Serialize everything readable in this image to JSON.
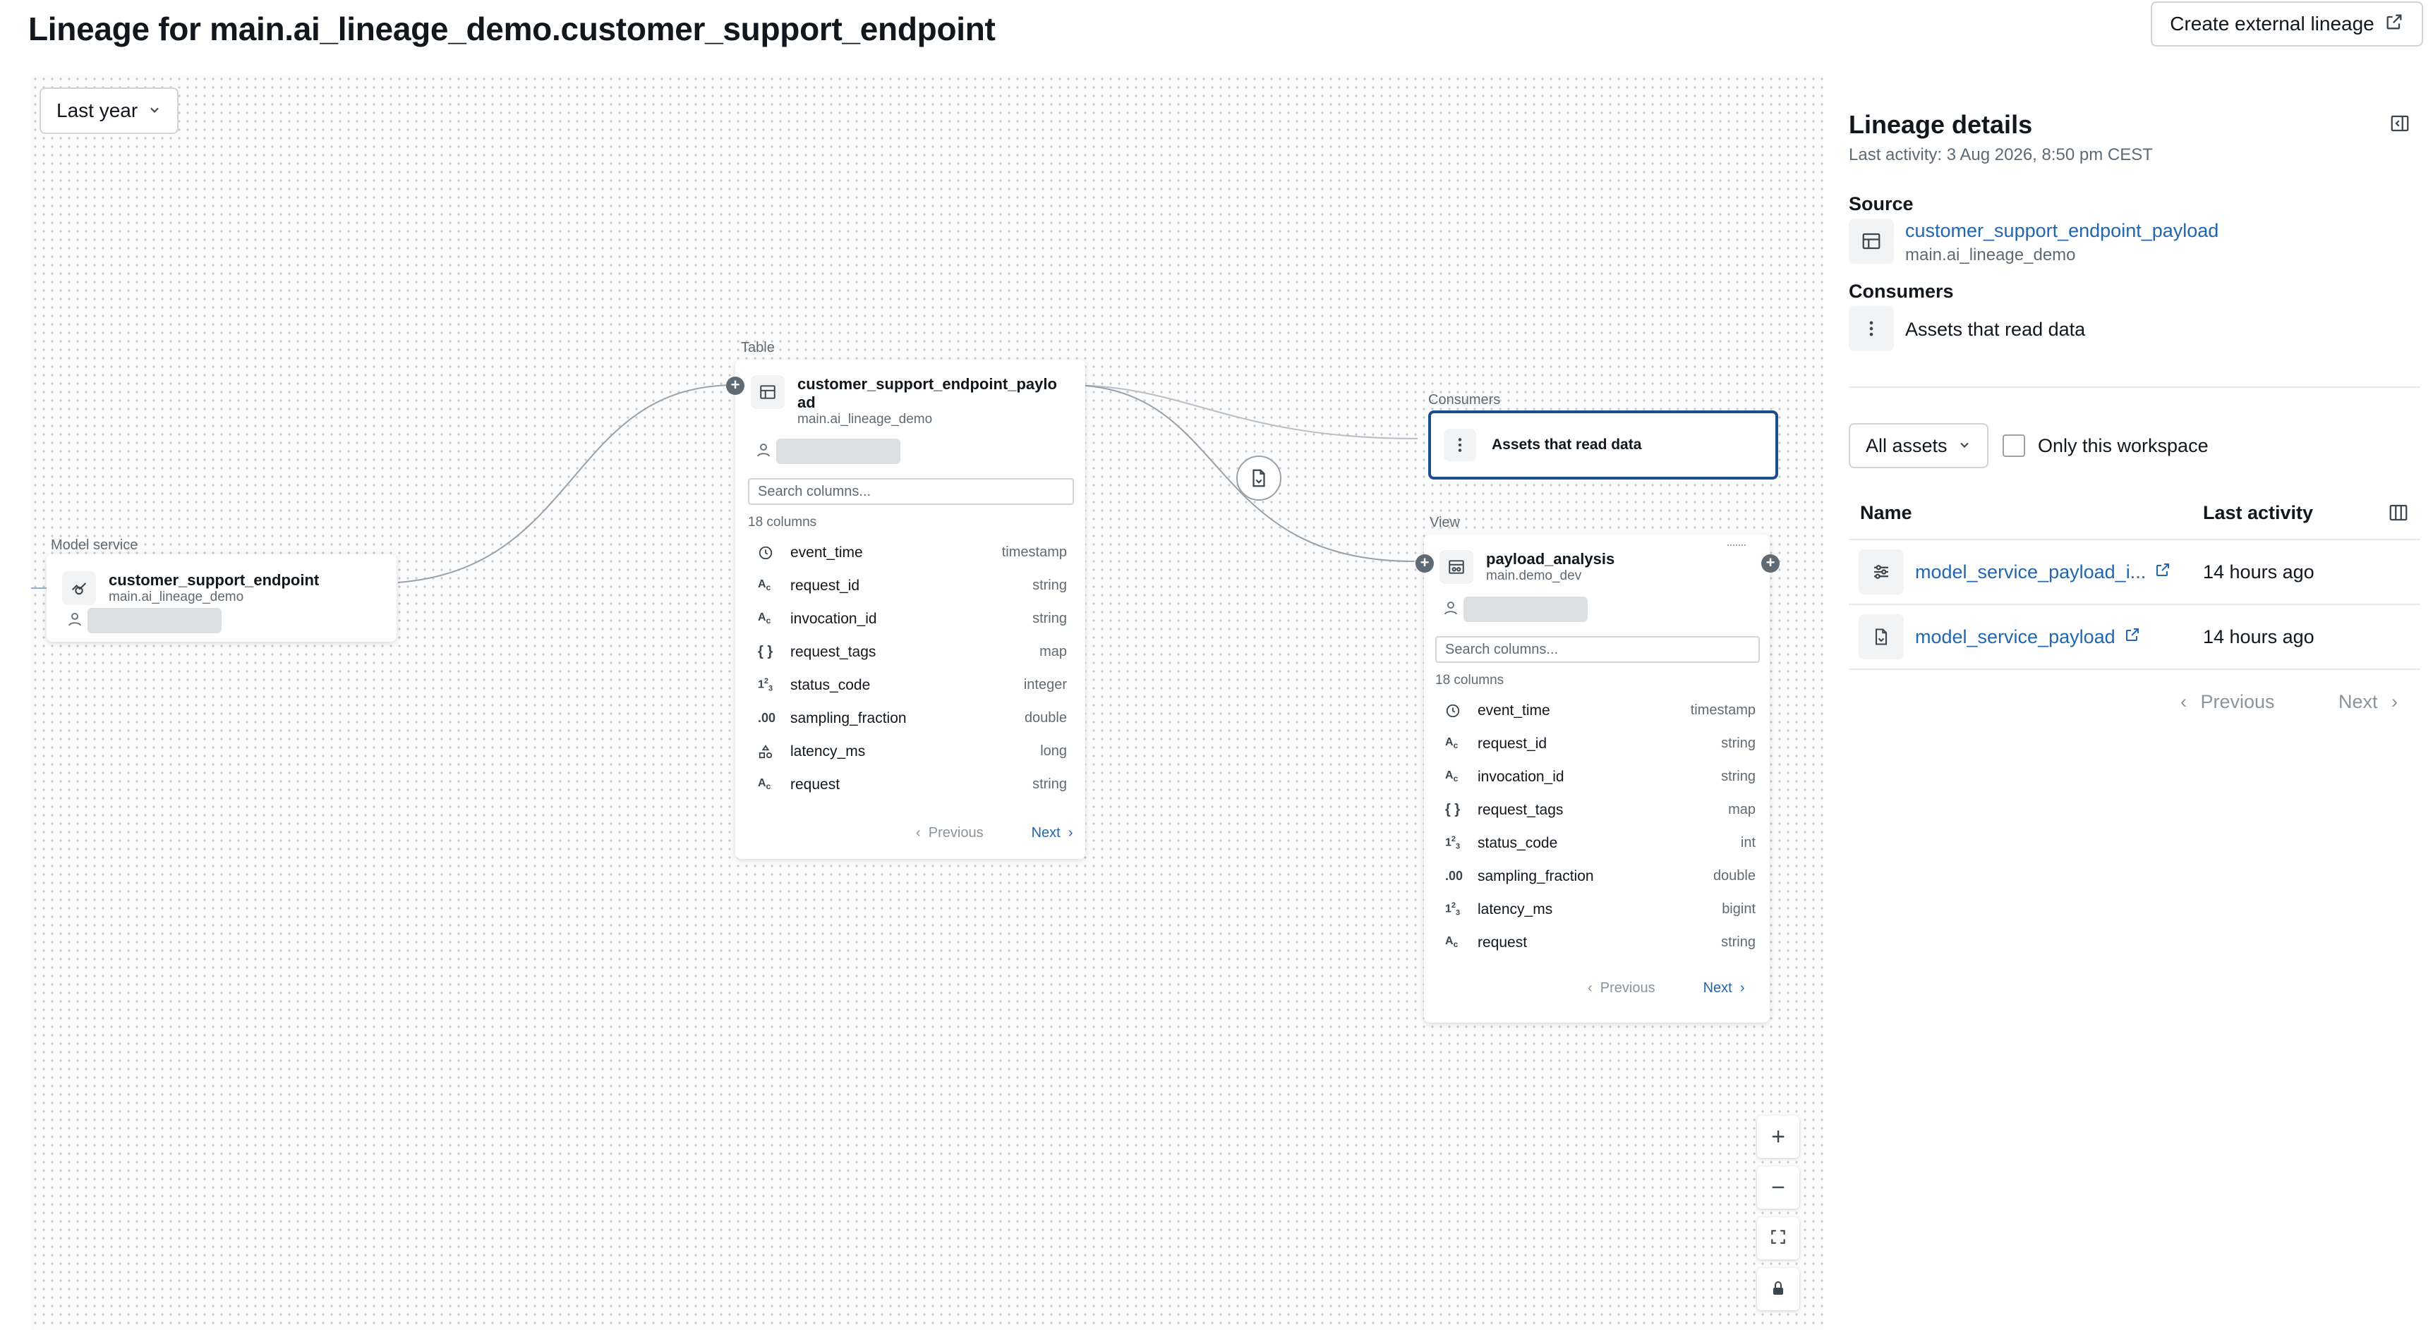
{
  "page": {
    "title": "Lineage for main.ai_lineage_demo.customer_support_endpoint",
    "external_button": "Create external lineage"
  },
  "canvas": {
    "time_filter": "Last year",
    "model_node": {
      "type_label": "Model service",
      "name": "customer_support_endpoint",
      "schema": "main.ai_lineage_demo"
    },
    "table_node": {
      "type_label": "Table",
      "name_line1": "customer_support_endpoint_paylo",
      "name_line2": "ad",
      "schema": "main.ai_lineage_demo",
      "search_placeholder": "Search columns...",
      "count": "18 columns",
      "columns": [
        {
          "icon": "clock-icon",
          "name": "event_time",
          "type": "timestamp"
        },
        {
          "icon": "string-icon",
          "name": "request_id",
          "type": "string"
        },
        {
          "icon": "string-icon",
          "name": "invocation_id",
          "type": "string"
        },
        {
          "icon": "braces-icon",
          "name": "request_tags",
          "type": "map"
        },
        {
          "icon": "integer-icon",
          "name": "status_code",
          "type": "integer"
        },
        {
          "icon": "decimal-icon",
          "name": "sampling_fraction",
          "type": "double"
        },
        {
          "icon": "shapes-icon",
          "name": "latency_ms",
          "type": "long"
        },
        {
          "icon": "string-icon",
          "name": "request",
          "type": "string"
        }
      ],
      "prev": "Previous",
      "next": "Next"
    },
    "consumers_node": {
      "type_label": "Consumers",
      "name": "Assets that read data"
    },
    "view_node": {
      "type_label": "View",
      "name": "payload_analysis",
      "schema": "main.demo_dev",
      "search_placeholder": "Search columns...",
      "count": "18 columns",
      "columns": [
        {
          "icon": "clock-icon",
          "name": "event_time",
          "type": "timestamp"
        },
        {
          "icon": "string-icon",
          "name": "request_id",
          "type": "string"
        },
        {
          "icon": "string-icon",
          "name": "invocation_id",
          "type": "string"
        },
        {
          "icon": "braces-icon",
          "name": "request_tags",
          "type": "map"
        },
        {
          "icon": "integer-icon",
          "name": "status_code",
          "type": "int"
        },
        {
          "icon": "decimal-icon",
          "name": "sampling_fraction",
          "type": "double"
        },
        {
          "icon": "integer-icon",
          "name": "latency_ms",
          "type": "bigint"
        },
        {
          "icon": "string-icon",
          "name": "request",
          "type": "string"
        }
      ],
      "prev": "Previous",
      "next": "Next"
    }
  },
  "details": {
    "title": "Lineage details",
    "last_activity": "Last activity: 3 Aug 2026, 8:50 pm CEST",
    "source_label": "Source",
    "source_name": "customer_support_endpoint_payload",
    "source_schema": "main.ai_lineage_demo",
    "consumers_label": "Consumers",
    "consumers_text": "Assets that read data",
    "filter": "All assets",
    "checkbox_label": "Only this workspace",
    "col_name": "Name",
    "col_activity": "Last activity",
    "rows": [
      {
        "name": "model_service_payload_i...",
        "activity": "14 hours ago"
      },
      {
        "name": "model_service_payload",
        "activity": "14 hours ago"
      }
    ],
    "prev": "Previous",
    "next": "Next"
  },
  "colors": {
    "link": "#2266b0",
    "selected_border": "#1e4d8c",
    "edge": "#98a2aa"
  }
}
